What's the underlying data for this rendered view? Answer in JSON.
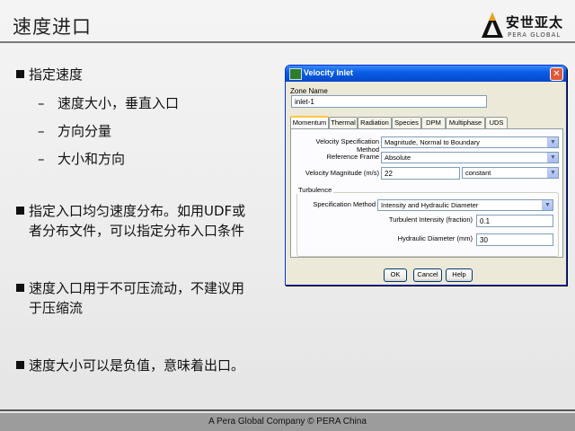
{
  "slide": {
    "title": "速度进口",
    "logo": {
      "brand": "安世亚太",
      "sub": "PERA GLOBAL"
    },
    "bullets": [
      {
        "lines": [
          "指定速度"
        ]
      },
      {
        "lines": [
          "指定入口均匀速度分布。如用UDF或",
          "者分布文件，可以指定分布入口条件"
        ]
      },
      {
        "lines": [
          "速度入口用于不可压流动，不建议用",
          "于压缩流"
        ]
      },
      {
        "lines": [
          "速度大小可以是负值，意味着出口。"
        ]
      }
    ],
    "sub_bullets": [
      "速度大小，垂直入口",
      "方向分量",
      "大小和方向"
    ],
    "dash": "–",
    "footer": "A Pera Global Company ©  PERA China"
  },
  "dialog": {
    "title": "Velocity Inlet",
    "zone_name_label": "Zone Name",
    "zone_name_value": "inlet-1",
    "tabs": [
      "Momentum",
      "Thermal",
      "Radiation",
      "Species",
      "DPM",
      "Multiphase",
      "UDS"
    ],
    "active_tab": "Momentum",
    "velocity_spec_label": "Velocity Specification Method",
    "velocity_spec_value": "Magnitude, Normal to Boundary",
    "reference_frame_label": "Reference Frame",
    "reference_frame_value": "Absolute",
    "velocity_mag_label": "Velocity Magnitude (m/s)",
    "velocity_mag_value": "22",
    "velocity_mag_profile": "constant",
    "turbulence_label": "Turbulence",
    "spec_method_label": "Specification Method",
    "spec_method_value": "Intensity and Hydraulic Diameter",
    "intensity_label": "Turbulent Intensity (fraction)",
    "intensity_value": "0.1",
    "hyd_diam_label": "Hydraulic Diameter (mm)",
    "hyd_diam_value": "30",
    "buttons": {
      "ok": "OK",
      "cancel": "Cancel",
      "help": "Help"
    },
    "close_glyph": "✕"
  }
}
